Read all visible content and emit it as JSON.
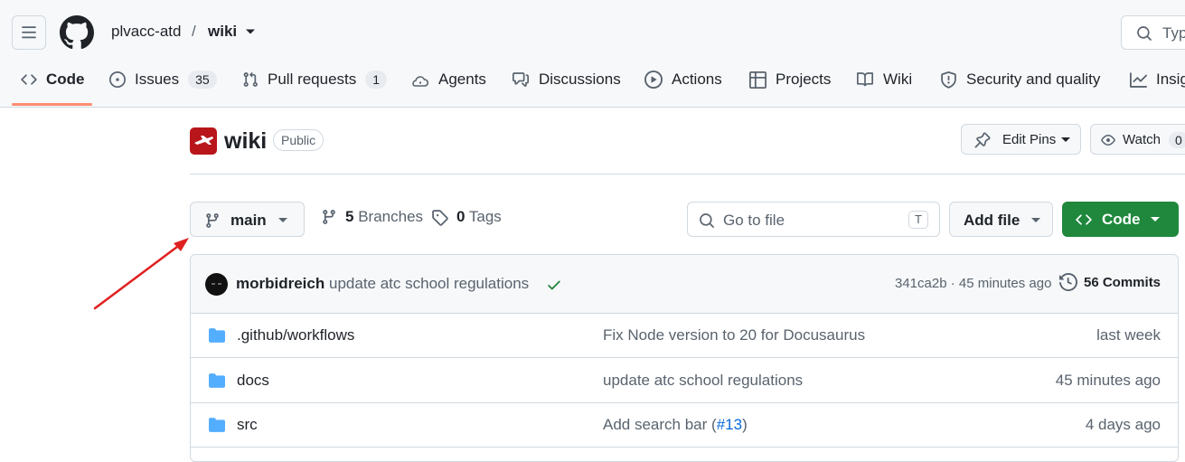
{
  "header": {
    "owner": "plvacc-atd",
    "separator": "/",
    "repo": "wiki",
    "search_placeholder": "Typ"
  },
  "tabs": [
    {
      "label": "Code",
      "icon": "code-icon",
      "selected": true
    },
    {
      "label": "Issues",
      "icon": "issue-icon",
      "count": "35"
    },
    {
      "label": "Pull requests",
      "icon": "pull-request-icon",
      "count": "1"
    },
    {
      "label": "Agents",
      "icon": "agents-icon"
    },
    {
      "label": "Discussions",
      "icon": "discussions-icon"
    },
    {
      "label": "Actions",
      "icon": "play-icon"
    },
    {
      "label": "Projects",
      "icon": "table-icon"
    },
    {
      "label": "Wiki",
      "icon": "book-icon"
    },
    {
      "label": "Security and quality",
      "icon": "shield-icon"
    },
    {
      "label": "Insig",
      "icon": "graph-icon"
    }
  ],
  "repo": {
    "name": "wiki",
    "visibility": "Public",
    "edit_pins_label": "Edit Pins",
    "watch_label": "Watch",
    "watch_count": "0"
  },
  "toolbar": {
    "branch": "main",
    "branches_count": "5",
    "branches_label": "Branches",
    "tags_count": "0",
    "tags_label": "Tags",
    "go_to_file_placeholder": "Go to file",
    "go_to_file_shortcut": "T",
    "add_file_label": "Add file",
    "code_label": "Code"
  },
  "commit": {
    "author": "morbidreich",
    "message": "update atc school regulations",
    "meta": "341ca2b · 45 minutes ago",
    "commits_label": "56 Commits"
  },
  "files": [
    {
      "name": ".github/workflows",
      "message": "Fix Node version to 20 for Docusaurus",
      "time": "last week"
    },
    {
      "name": "docs",
      "message": "update atc school regulations",
      "time": "45 minutes ago"
    },
    {
      "name": "src",
      "message": "Add search bar (",
      "link": "#13",
      "message_end": ")",
      "time": "4 days ago"
    }
  ],
  "colors": {
    "accent_tab": "#fd8c73",
    "primary_button": "#1f883d",
    "folder": "#54aeff",
    "annotation_arrow": "#e02020"
  }
}
